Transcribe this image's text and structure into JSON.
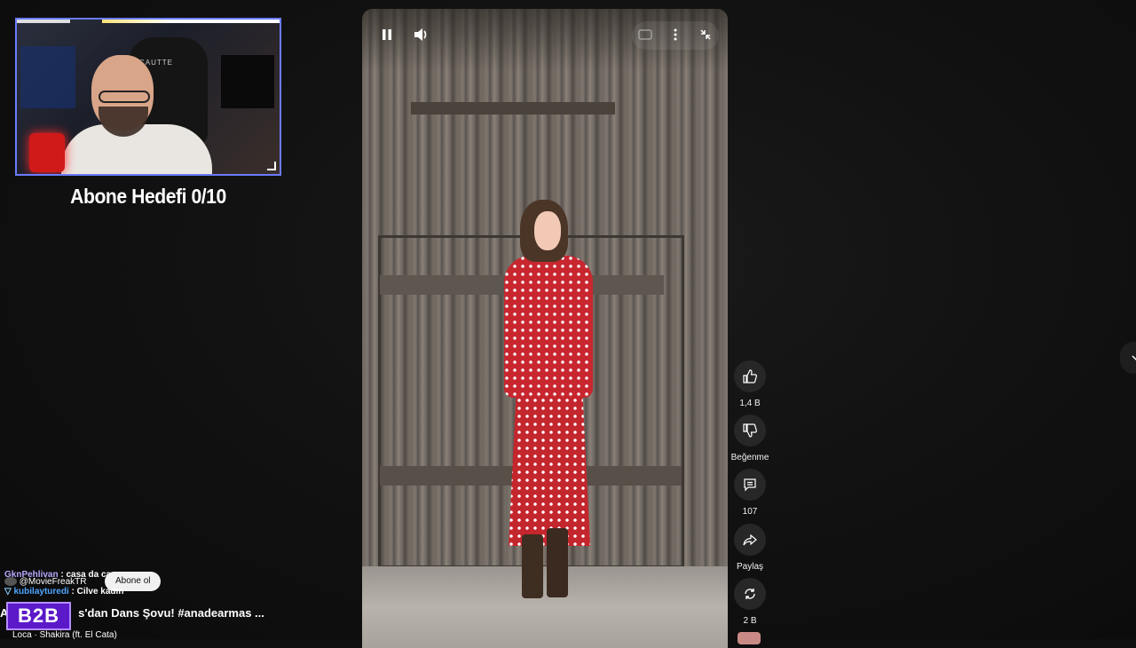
{
  "overlay": {
    "goal_text": "Abone Hedefi 0/10",
    "webcam_chair_brand": "CAUTTE"
  },
  "player": {
    "controls": [
      "pause-icon",
      "volume-icon",
      "captions-icon",
      "more-icon",
      "collapse-icon"
    ]
  },
  "actions": [
    {
      "icon": "like-icon",
      "label": "1,4 B"
    },
    {
      "icon": "dislike-icon",
      "label": "Beğenme"
    },
    {
      "icon": "comment-icon",
      "label": "107"
    },
    {
      "icon": "share-icon",
      "label": "Paylaş"
    },
    {
      "icon": "remix-icon",
      "label": "2 B"
    }
  ],
  "chat": {
    "line1_user": "GknPehlivan",
    "line1_msg": ": casa da casa",
    "channel": "@MovieFreakTR",
    "subscribe_label": "Abone ol",
    "line2_user": "kubilayturedi",
    "line2_msg": ": Cilve kadın",
    "title_prefix": "A",
    "title": "s'dan Dans Şovu! #anadearmas ...",
    "music": "Loca · Shakira (ft. El Cata)",
    "badge": "B2B"
  },
  "colors": {
    "background": "#0f0f0f",
    "webcam_border": "#6a7cff",
    "chat_user_purple": "#b9a7ff",
    "chat_user_blue": "#4ea4ff",
    "badge_purple": "#5b19c9"
  }
}
